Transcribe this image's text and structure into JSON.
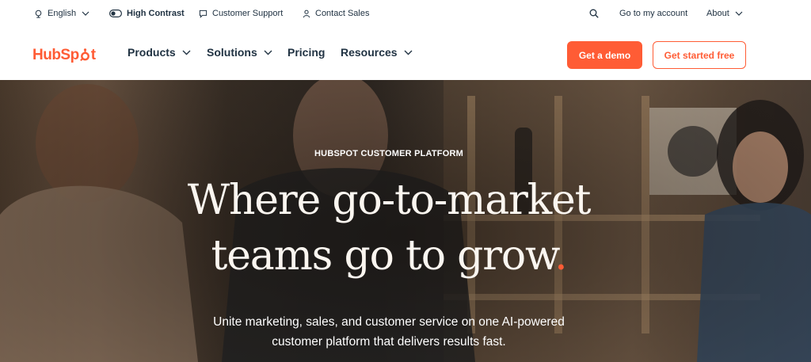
{
  "utility_bar": {
    "language": "English",
    "high_contrast": "High Contrast",
    "customer_support": "Customer Support",
    "contact_sales": "Contact Sales",
    "account": "Go to my account",
    "about": "About"
  },
  "nav": {
    "logo": {
      "part1": "HubSp",
      "part2": "t"
    },
    "items": [
      {
        "label": "Products",
        "has_dropdown": true
      },
      {
        "label": "Solutions",
        "has_dropdown": true
      },
      {
        "label": "Pricing",
        "has_dropdown": false
      },
      {
        "label": "Resources",
        "has_dropdown": true
      }
    ],
    "cta_demo": "Get a demo",
    "cta_free": "Get started free"
  },
  "hero": {
    "eyebrow": "HUBSPOT CUSTOMER PLATFORM",
    "headline_line1": "Where go-to-market",
    "headline_line2": "teams go to grow",
    "headline_dot": ".",
    "subhead_line1": "Unite marketing, sales, and customer service on one AI-powered",
    "subhead_line2": "customer platform that delivers results fast."
  },
  "colors": {
    "brand_orange": "#ff5c35",
    "text_dark": "#213343",
    "headline_cream": "#fbf6f0"
  },
  "icons": {
    "language": "globe-icon",
    "contrast": "toggle-icon",
    "support": "chat-icon",
    "sales": "person-icon",
    "search": "search-icon"
  }
}
